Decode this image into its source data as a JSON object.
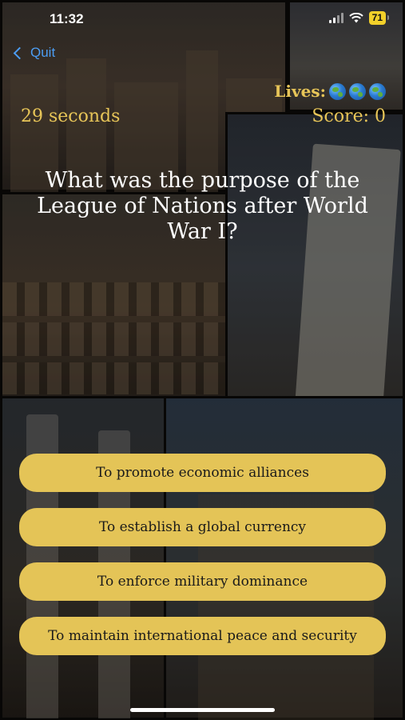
{
  "status_bar": {
    "time": "11:32",
    "battery": "71"
  },
  "header": {
    "quit_label": "Quit",
    "lives_label": "Lives:",
    "lives_count": 3,
    "timer": "29 seconds",
    "score": "Score: 0"
  },
  "question": {
    "text": "What was the purpose of the League of Nations after World War I?"
  },
  "answers": [
    {
      "label": "To promote economic alliances"
    },
    {
      "label": "To establish a global currency"
    },
    {
      "label": "To enforce military dominance"
    },
    {
      "label": "To maintain international peace and security"
    }
  ],
  "colors": {
    "accent_gold": "#e7c558",
    "button_gold": "#e4c457",
    "link_blue": "#4c9df3"
  },
  "icons": [
    "back-chevron-icon",
    "globe-icon",
    "signal-icon",
    "wifi-icon",
    "battery-icon"
  ]
}
